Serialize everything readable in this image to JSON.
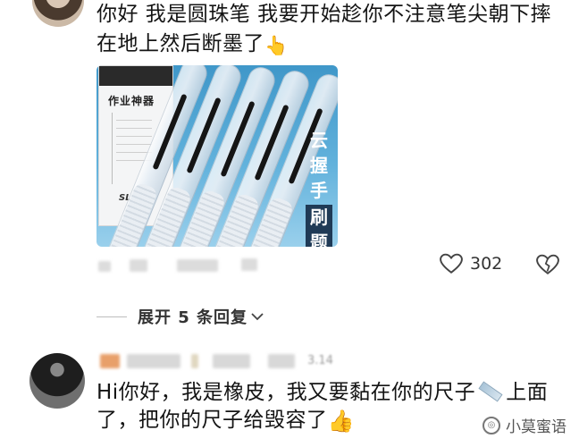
{
  "comment": {
    "text": "你好 我是圆珠笔 我要开始趁你不注意笔尖朝下摔在地上然后断墨了",
    "emoji": "👆",
    "image": {
      "box_title": "作业神器",
      "box_logo": "SL",
      "side_text_top": "云握手",
      "side_text_dark": "刷题"
    },
    "like_count": "302",
    "icons": {
      "like": "heart-icon",
      "dislike": "broken-heart-icon"
    }
  },
  "expand": {
    "label": "展开 5 条回复",
    "icon": "chevron-down-icon"
  },
  "reply": {
    "text_before_ruler": "Hi你好，我是橡皮，我又要黏在你的尺子",
    "text_after_ruler": "上面了，把你的尺子给毁容了",
    "emoji": "👍",
    "date_hint": "3.14"
  },
  "watermark": {
    "label": "小莫蜜语"
  },
  "colors": {
    "text": "#141414",
    "muted": "#555555",
    "image_bg": "#3f97c9"
  }
}
